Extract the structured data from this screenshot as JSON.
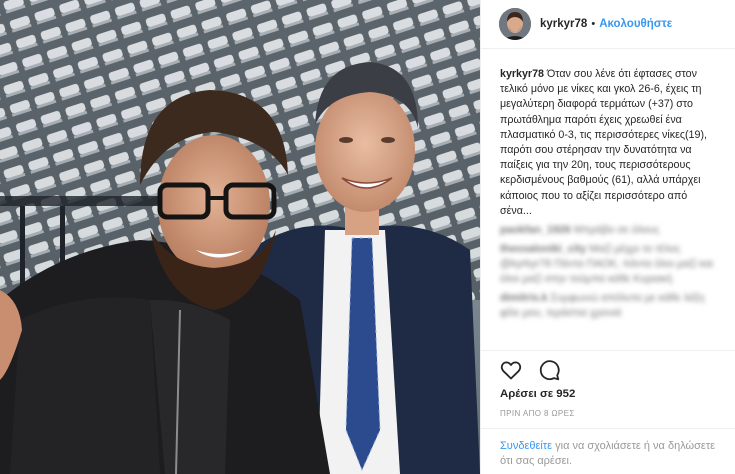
{
  "post": {
    "username": "kyrkyr78",
    "follow_label": "Ακολουθήστε",
    "dot": "•",
    "caption": "Όταν σου λένε ότι έφτασες στον τελικό μόνο με νίκες και γκολ 26-6, έχεις τη μεγαλύτερη διαφορά τερμάτων (+37) στο πρωτάθλημα παρότι έχεις χρεωθεί ένα πλασματικό 0-3, τις περισσότερες νίκες(19), παρότι σου στέρησαν την δυνατότητα να παίξεις για την 20η, τους περισσότερους κερδισμένους βαθμούς (61), αλλά υπάρχει κάποιος που το αξίζει περισσότερο από σένα...",
    "blurred_comments": [
      {
        "user": "paokfan_1926",
        "text": "Μπράβο σε όλους"
      },
      {
        "user": "thessaloniki_city",
        "text": "Μαζί μέχρι το τέλος @kyrkyr78 Πάντα ΠΑΟΚ, πάντα όλοι μαζί και όλοι μαζί στην τούμπα κάθε Κυριακή"
      },
      {
        "user": "dimitris.k",
        "text": "Συμφωνώ απόλυτα με κάθε λέξη φίλε μου, τεράστια χρονιά"
      }
    ],
    "likes": "Αρέσει σε 952",
    "time": "ΠΡΙΝ ΑΠΟ 8 ΩΡΕΣ",
    "login_link": "Συνδεθείτε",
    "login_text": " για να σχολιάσετε ή να δηλώσετε ότι σας αρέσει."
  },
  "icons": {
    "like": "heart-icon",
    "comment": "comment-icon"
  },
  "colors": {
    "link": "#3897f0",
    "text": "#262626",
    "muted": "#999999",
    "border": "#efefef"
  }
}
